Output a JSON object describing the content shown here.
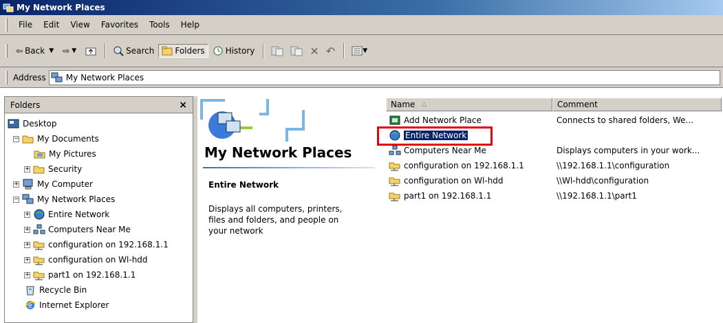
{
  "window": {
    "title": "My Network Places"
  },
  "menu": [
    "File",
    "Edit",
    "View",
    "Favorites",
    "Tools",
    "Help"
  ],
  "toolbar": {
    "back": "Back",
    "search": "Search",
    "folders": "Folders",
    "history": "History"
  },
  "address": {
    "label": "Address",
    "value": "My Network Places"
  },
  "folders_pane": {
    "title": "Folders",
    "close": "×",
    "tree": [
      {
        "label": "Desktop"
      },
      {
        "label": "My Documents"
      },
      {
        "label": "My Pictures"
      },
      {
        "label": "Security"
      },
      {
        "label": "My Computer"
      },
      {
        "label": "My Network Places"
      },
      {
        "label": "Entire Network"
      },
      {
        "label": "Computers Near Me"
      },
      {
        "label": "configuration on 192.168.1.1"
      },
      {
        "label": "configuration on Wl-hdd"
      },
      {
        "label": "part1 on 192.168.1.1"
      },
      {
        "label": "Recycle Bin"
      },
      {
        "label": "Internet Explorer"
      }
    ]
  },
  "info_panel": {
    "title": "My Network Places",
    "selected_title": "Entire Network",
    "selected_desc": "Displays all computers, printers, files and folders, and people on your network"
  },
  "list": {
    "columns": {
      "name": "Name",
      "comment": "Comment"
    },
    "rows": [
      {
        "name": "Add Network Place",
        "comment": "Connects to shared folders, We..."
      },
      {
        "name": "Entire Network",
        "comment": ""
      },
      {
        "name": "Computers Near Me",
        "comment": "Displays computers in your work..."
      },
      {
        "name": "configuration on 192.168.1.1",
        "comment": "\\\\192.168.1.1\\configuration"
      },
      {
        "name": "configuration on Wl-hdd",
        "comment": "\\\\Wl-hdd\\configuration"
      },
      {
        "name": "part1 on 192.168.1.1",
        "comment": "\\\\192.168.1.1\\part1"
      }
    ]
  },
  "colors": {
    "titlebar": "#0a246a",
    "selection": "#0a246a",
    "highlight": "#e3000f",
    "chrome": "#d4d0c8"
  }
}
